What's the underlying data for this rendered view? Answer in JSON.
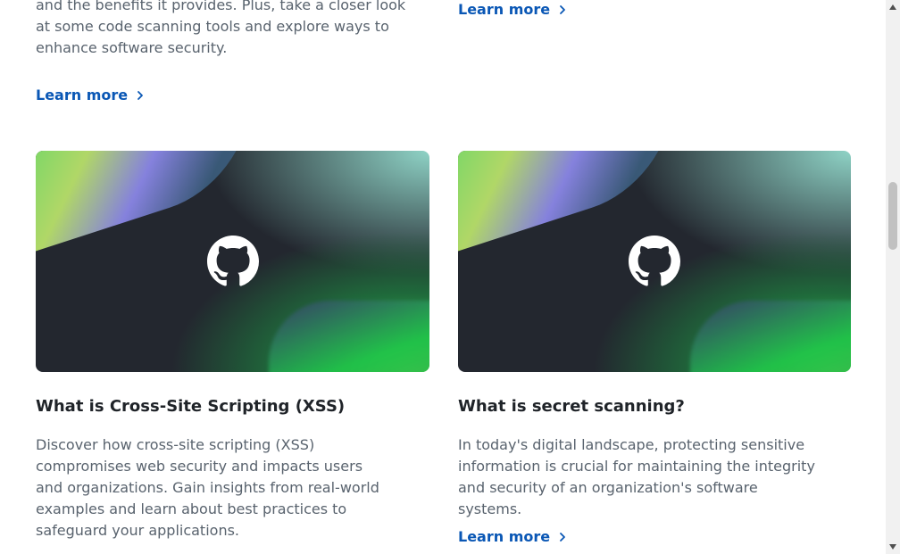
{
  "top_left": {
    "text_lines": [
      "and the benefits it provides. Plus, take a closer look",
      "at some code scanning tools and explore ways to",
      "enhance software security."
    ],
    "learn_more": "Learn more"
  },
  "top_right": {
    "learn_more": "Learn more"
  },
  "cards": [
    {
      "title": "What is Cross-Site Scripting (XSS)",
      "description": "Discover how cross-site scripting (XSS) compromises web security and impacts users and organizations. Gain insights from real-world examples and learn about best practices to safeguard your applications.",
      "image_icon": "github-logo-icon"
    },
    {
      "title": "What is secret scanning?",
      "description": "In today's digital landscape, protecting sensitive information is crucial for maintaining the integrity and security of an organization's software systems.",
      "learn_more": "Learn more",
      "image_icon": "github-logo-icon"
    }
  ],
  "colors": {
    "link": "#0a57b5",
    "body_text": "#59636e",
    "heading": "#1f2328",
    "card_bg": "#23272f"
  }
}
